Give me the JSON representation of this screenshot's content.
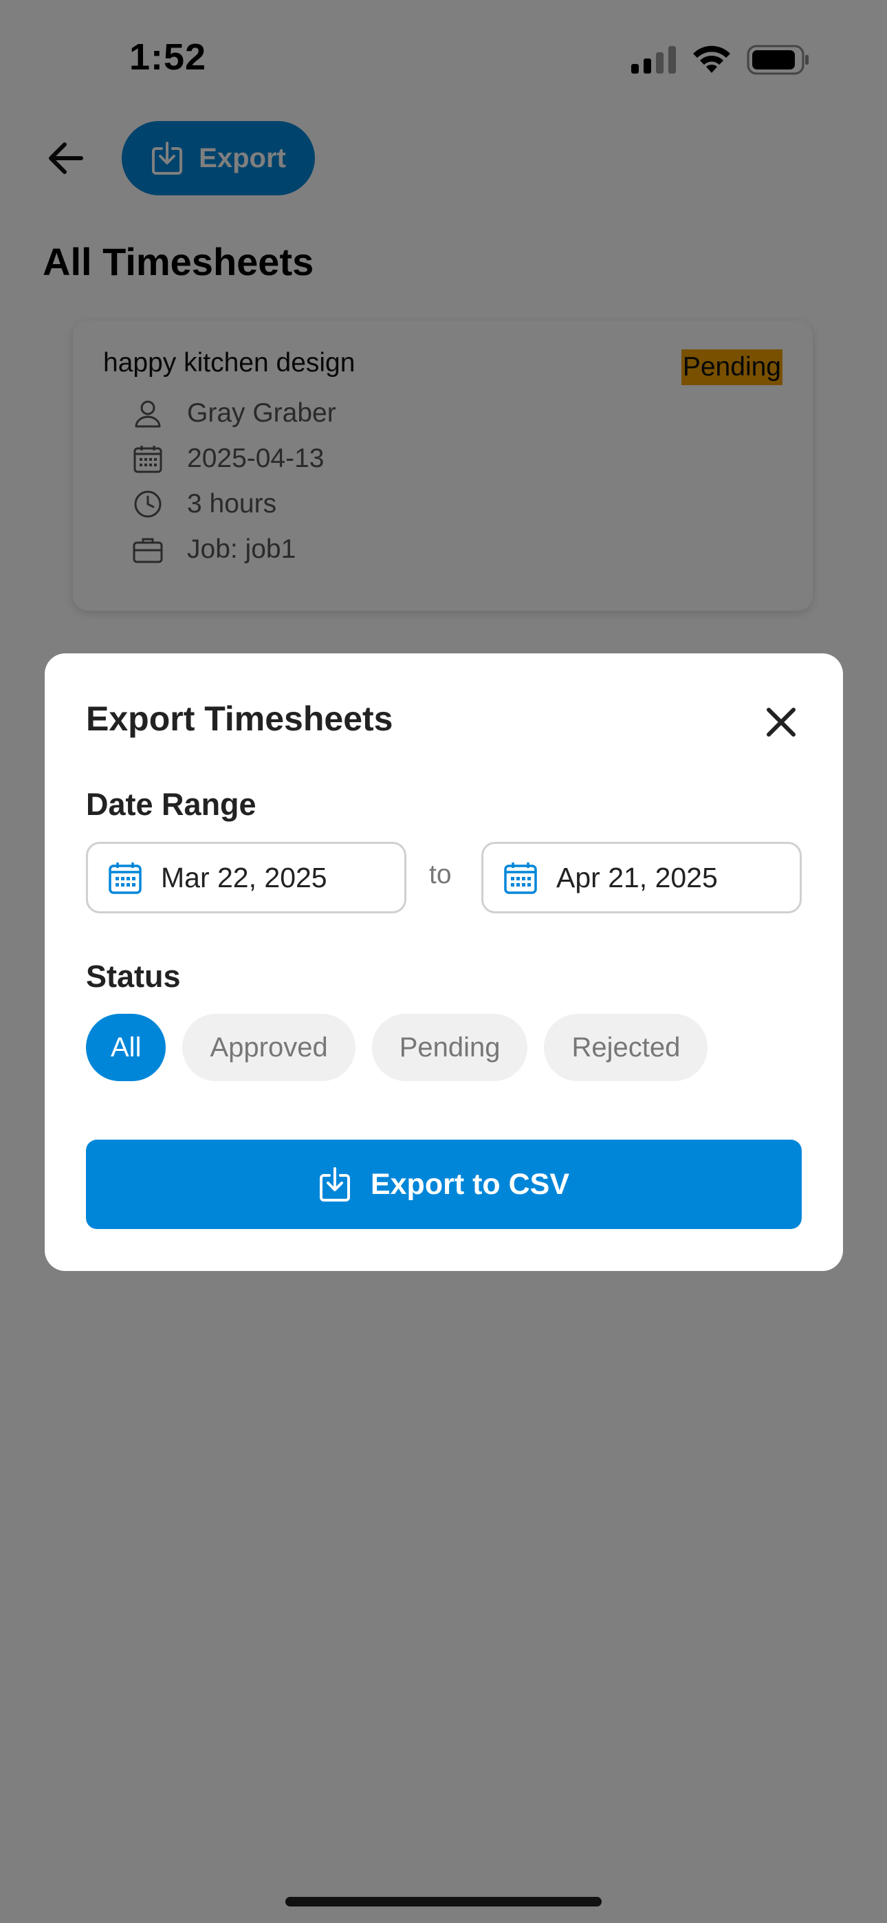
{
  "status_bar": {
    "time": "1:52"
  },
  "header": {
    "export_label": "Export",
    "title": "All Timesheets"
  },
  "timesheet": {
    "title": "happy kitchen design",
    "status": "Pending",
    "employee": "Gray Graber",
    "date": "2025-04-13",
    "duration": "3 hours",
    "job": "Job: job1"
  },
  "modal": {
    "title": "Export Timesheets",
    "date_range_label": "Date Range",
    "start_date": "Mar 22, 2025",
    "to_label": "to",
    "end_date": "Apr 21, 2025",
    "status_label": "Status",
    "status_options": [
      "All",
      "Approved",
      "Pending",
      "Rejected"
    ],
    "selected_status": "All",
    "export_button": "Export to CSV"
  },
  "colors": {
    "accent": "#0086d9",
    "pending_badge": "#f0a000",
    "chip_inactive": "#f0f0f0",
    "overlay": "rgba(0,0,0,0.5)"
  }
}
